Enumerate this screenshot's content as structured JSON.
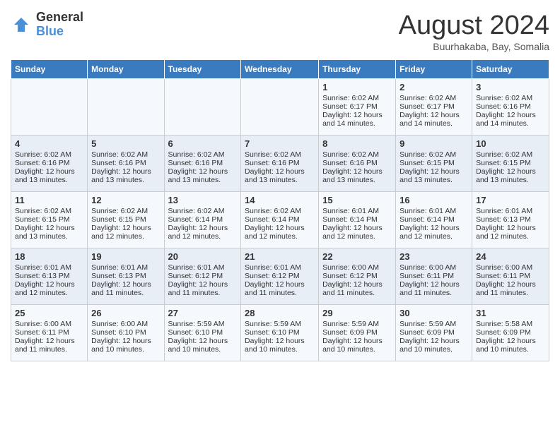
{
  "header": {
    "logo_line1": "General",
    "logo_line2": "Blue",
    "title": "August 2024",
    "subtitle": "Buurhakaba, Bay, Somalia"
  },
  "days_of_week": [
    "Sunday",
    "Monday",
    "Tuesday",
    "Wednesday",
    "Thursday",
    "Friday",
    "Saturday"
  ],
  "weeks": [
    [
      {
        "day": "",
        "text": ""
      },
      {
        "day": "",
        "text": ""
      },
      {
        "day": "",
        "text": ""
      },
      {
        "day": "",
        "text": ""
      },
      {
        "day": "1",
        "text": "Sunrise: 6:02 AM\nSunset: 6:17 PM\nDaylight: 12 hours\nand 14 minutes."
      },
      {
        "day": "2",
        "text": "Sunrise: 6:02 AM\nSunset: 6:17 PM\nDaylight: 12 hours\nand 14 minutes."
      },
      {
        "day": "3",
        "text": "Sunrise: 6:02 AM\nSunset: 6:16 PM\nDaylight: 12 hours\nand 14 minutes."
      }
    ],
    [
      {
        "day": "4",
        "text": "Sunrise: 6:02 AM\nSunset: 6:16 PM\nDaylight: 12 hours\nand 13 minutes."
      },
      {
        "day": "5",
        "text": "Sunrise: 6:02 AM\nSunset: 6:16 PM\nDaylight: 12 hours\nand 13 minutes."
      },
      {
        "day": "6",
        "text": "Sunrise: 6:02 AM\nSunset: 6:16 PM\nDaylight: 12 hours\nand 13 minutes."
      },
      {
        "day": "7",
        "text": "Sunrise: 6:02 AM\nSunset: 6:16 PM\nDaylight: 12 hours\nand 13 minutes."
      },
      {
        "day": "8",
        "text": "Sunrise: 6:02 AM\nSunset: 6:16 PM\nDaylight: 12 hours\nand 13 minutes."
      },
      {
        "day": "9",
        "text": "Sunrise: 6:02 AM\nSunset: 6:15 PM\nDaylight: 12 hours\nand 13 minutes."
      },
      {
        "day": "10",
        "text": "Sunrise: 6:02 AM\nSunset: 6:15 PM\nDaylight: 12 hours\nand 13 minutes."
      }
    ],
    [
      {
        "day": "11",
        "text": "Sunrise: 6:02 AM\nSunset: 6:15 PM\nDaylight: 12 hours\nand 13 minutes."
      },
      {
        "day": "12",
        "text": "Sunrise: 6:02 AM\nSunset: 6:15 PM\nDaylight: 12 hours\nand 12 minutes."
      },
      {
        "day": "13",
        "text": "Sunrise: 6:02 AM\nSunset: 6:14 PM\nDaylight: 12 hours\nand 12 minutes."
      },
      {
        "day": "14",
        "text": "Sunrise: 6:02 AM\nSunset: 6:14 PM\nDaylight: 12 hours\nand 12 minutes."
      },
      {
        "day": "15",
        "text": "Sunrise: 6:01 AM\nSunset: 6:14 PM\nDaylight: 12 hours\nand 12 minutes."
      },
      {
        "day": "16",
        "text": "Sunrise: 6:01 AM\nSunset: 6:14 PM\nDaylight: 12 hours\nand 12 minutes."
      },
      {
        "day": "17",
        "text": "Sunrise: 6:01 AM\nSunset: 6:13 PM\nDaylight: 12 hours\nand 12 minutes."
      }
    ],
    [
      {
        "day": "18",
        "text": "Sunrise: 6:01 AM\nSunset: 6:13 PM\nDaylight: 12 hours\nand 12 minutes."
      },
      {
        "day": "19",
        "text": "Sunrise: 6:01 AM\nSunset: 6:13 PM\nDaylight: 12 hours\nand 11 minutes."
      },
      {
        "day": "20",
        "text": "Sunrise: 6:01 AM\nSunset: 6:12 PM\nDaylight: 12 hours\nand 11 minutes."
      },
      {
        "day": "21",
        "text": "Sunrise: 6:01 AM\nSunset: 6:12 PM\nDaylight: 12 hours\nand 11 minutes."
      },
      {
        "day": "22",
        "text": "Sunrise: 6:00 AM\nSunset: 6:12 PM\nDaylight: 12 hours\nand 11 minutes."
      },
      {
        "day": "23",
        "text": "Sunrise: 6:00 AM\nSunset: 6:11 PM\nDaylight: 12 hours\nand 11 minutes."
      },
      {
        "day": "24",
        "text": "Sunrise: 6:00 AM\nSunset: 6:11 PM\nDaylight: 12 hours\nand 11 minutes."
      }
    ],
    [
      {
        "day": "25",
        "text": "Sunrise: 6:00 AM\nSunset: 6:11 PM\nDaylight: 12 hours\nand 11 minutes."
      },
      {
        "day": "26",
        "text": "Sunrise: 6:00 AM\nSunset: 6:10 PM\nDaylight: 12 hours\nand 10 minutes."
      },
      {
        "day": "27",
        "text": "Sunrise: 5:59 AM\nSunset: 6:10 PM\nDaylight: 12 hours\nand 10 minutes."
      },
      {
        "day": "28",
        "text": "Sunrise: 5:59 AM\nSunset: 6:10 PM\nDaylight: 12 hours\nand 10 minutes."
      },
      {
        "day": "29",
        "text": "Sunrise: 5:59 AM\nSunset: 6:09 PM\nDaylight: 12 hours\nand 10 minutes."
      },
      {
        "day": "30",
        "text": "Sunrise: 5:59 AM\nSunset: 6:09 PM\nDaylight: 12 hours\nand 10 minutes."
      },
      {
        "day": "31",
        "text": "Sunrise: 5:58 AM\nSunset: 6:09 PM\nDaylight: 12 hours\nand 10 minutes."
      }
    ]
  ]
}
